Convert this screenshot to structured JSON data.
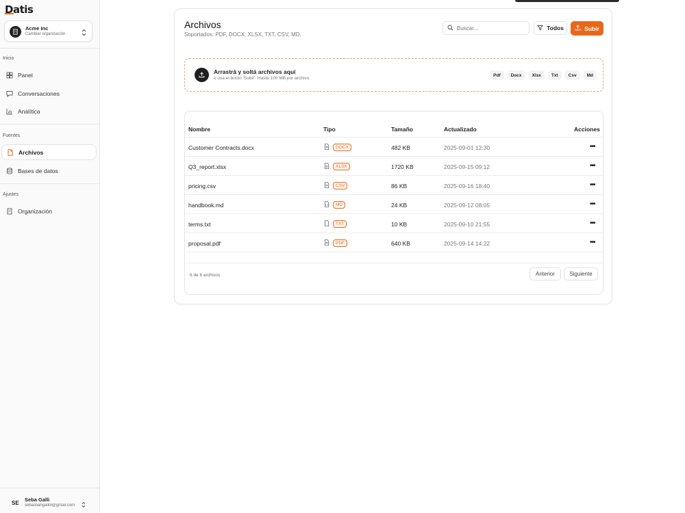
{
  "sidebar": {
    "logo": "Datis",
    "org": {
      "name": "Acme Inc",
      "subtitle": "Cambiar organización"
    },
    "sections": [
      {
        "label": "Inicio",
        "items": [
          {
            "label": "Panel",
            "icon": "dashboard-icon"
          },
          {
            "label": "Conversaciones",
            "icon": "chat-icon"
          },
          {
            "label": "Analítica",
            "icon": "chart-icon"
          }
        ]
      },
      {
        "label": "Fuentes",
        "items": [
          {
            "label": "Archivos",
            "icon": "file-icon",
            "active": true
          },
          {
            "label": "Bases de datos",
            "icon": "database-icon"
          }
        ]
      },
      {
        "label": "Ajustes",
        "items": [
          {
            "label": "Organización",
            "icon": "building-icon"
          }
        ]
      }
    ],
    "user": {
      "initials": "SE",
      "name": "Seba Galli",
      "email": "sebastiangalli9@gmail.com"
    }
  },
  "header": {
    "title": "Archivos",
    "subtitle": "Soportados: PDF, DOCX, XLSX, TXT, CSV, MD.",
    "search_placeholder": "Buscar...",
    "filter_label": "Todos",
    "upload_label": "Subir"
  },
  "dropzone": {
    "title": "Arrastrá y soltá archivos aquí",
    "subtitle": "o usa el botón 'Subir'. Hasta 100 MB por archivo.",
    "chips": [
      "Pdf",
      "Docx",
      "Xlsx",
      "Txt",
      "Csv",
      "Md"
    ]
  },
  "table": {
    "headers": {
      "name": "Nombre",
      "type": "Tipo",
      "size": "Tamaño",
      "updated": "Actualizado",
      "actions": "Acciones"
    },
    "rows": [
      {
        "name": "Customer Contracts.docx",
        "type": "DOCX",
        "size": "482 KB",
        "updated": "2025-09-01 12:30"
      },
      {
        "name": "Q3_report.xlsx",
        "type": "XLSX",
        "size": "1720 KB",
        "updated": "2025-09-15 09:12"
      },
      {
        "name": "pricing.csv",
        "type": "CSV",
        "size": "86 KB",
        "updated": "2025-09-16 18:40"
      },
      {
        "name": "handbook.md",
        "type": "MD",
        "size": "24 KB",
        "updated": "2025-09-12 08:05"
      },
      {
        "name": "terms.txt",
        "type": "TXT",
        "size": "10 KB",
        "updated": "2025-09-10 21:55"
      },
      {
        "name": "proposal.pdf",
        "type": "PDF",
        "size": "640 KB",
        "updated": "2025-09-14 14:22"
      }
    ],
    "count_text": "6 de 6 archivos",
    "prev_label": "Anterior",
    "next_label": "Siguiente"
  },
  "colors": {
    "accent": "#e8681b",
    "dark": "#1f1f1f",
    "border": "#e4e4e4"
  }
}
